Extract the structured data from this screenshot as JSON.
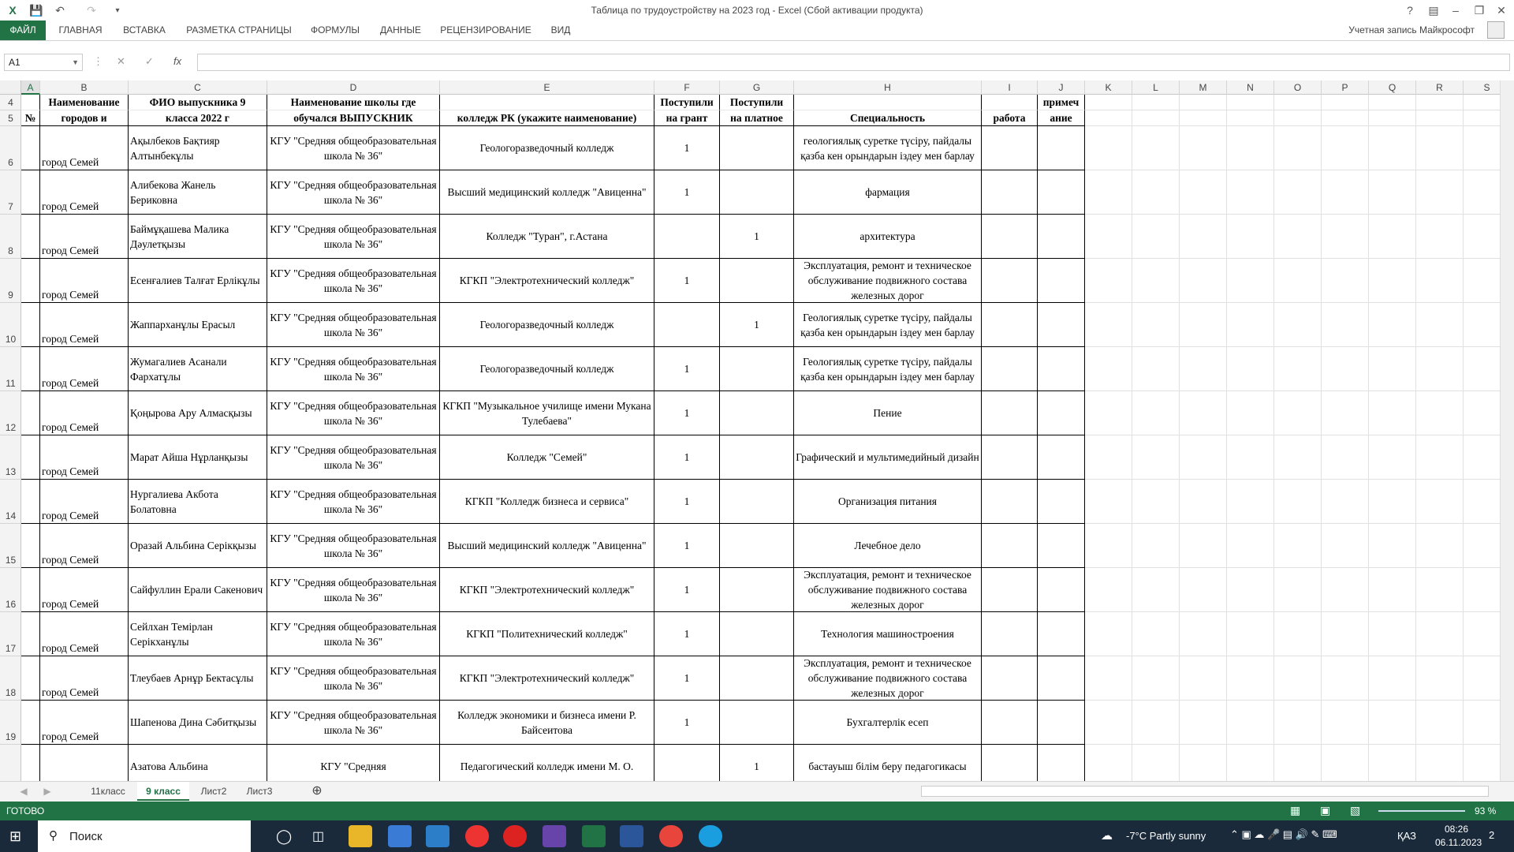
{
  "title": "Таблица по трудоустройству на 2023 год - Excel (Сбой активации продукта)",
  "ribbon": {
    "tabs": [
      "ФАЙЛ",
      "ГЛАВНАЯ",
      "ВСТАВКА",
      "РАЗМЕТКА СТРАНИЦЫ",
      "ФОРМУЛЫ",
      "ДАННЫЕ",
      "РЕЦЕНЗИРОВАНИЕ",
      "ВИД"
    ],
    "account": "Учетная запись Майкрософт"
  },
  "formula_bar": {
    "name_box": "A1",
    "fx": "fx",
    "value": ""
  },
  "columns": [
    "A",
    "B",
    "C",
    "D",
    "E",
    "F",
    "G",
    "H",
    "I",
    "J",
    "K",
    "L",
    "M",
    "N",
    "O",
    "P",
    "Q",
    "R",
    "S"
  ],
  "header": {
    "row4": {
      "B": "Наименование",
      "C": "ФИО выпускника 9",
      "D": "Наименование школы где",
      "F": "Поступили",
      "G": "Поступили",
      "J": "примеч"
    },
    "row5": {
      "A": "№",
      "B": "городов и",
      "C": "класса 2022 г",
      "D": "обучался ВЫПУСКНИК",
      "E": "колледж РК (укажите наименование)",
      "F": "на грант",
      "G": "на платное",
      "H": "Специальность",
      "I": "работа",
      "J": "ание"
    },
    "row_numbers": [
      "4",
      "5"
    ]
  },
  "rows": [
    {
      "num": "6",
      "city": "город Семей",
      "fio": "Ақылбеков Бақтияр Алтынбекұлы",
      "school": "КГУ \"Средняя общеобразовательная школа № 36\"",
      "college": "Геологоразведочный колледж",
      "grant": "1",
      "paid": "",
      "spec": "геологиялық суретке түсіру, пайдалы қазба кен орындарын іздеу мен барлау"
    },
    {
      "num": "7",
      "city": "город Семей",
      "fio": "Алибекова Жанель Бериковна",
      "school": "КГУ \"Средняя общеобразовательная школа № 36\"",
      "college": "Высший медицинский колледж \"Авиценна\"",
      "grant": "1",
      "paid": "",
      "spec": "фармация"
    },
    {
      "num": "8",
      "city": "город Семей",
      "fio": "Баймұқашева Малика Дәулетқызы",
      "school": "КГУ \"Средняя общеобразовательная школа № 36\"",
      "college": "Колледж \"Туран\", г.Астана",
      "grant": "",
      "paid": "1",
      "spec": "архитектура"
    },
    {
      "num": "9",
      "city": "город Семей",
      "fio": "Есенғалиев Талғат Ерлікұлы",
      "school": "КГУ \"Средняя общеобразовательная школа № 36\"",
      "college": "КГКП \"Электротехнический колледж\"",
      "grant": "1",
      "paid": "",
      "spec": "Эксплуатация, ремонт и техническое обслуживание подвижного состава железных дорог"
    },
    {
      "num": "10",
      "city": "город Семей",
      "fio": "Жаппарханұлы Ерасыл",
      "school": "КГУ \"Средняя общеобразовательная школа № 36\"",
      "college": "Геологоразведочный колледж",
      "grant": "",
      "paid": "1",
      "spec": "Геологиялық суретке түсіру, пайдалы қазба кен орындарын іздеу мен барлау"
    },
    {
      "num": "11",
      "city": "город Семей",
      "fio": "Жумагалиев Асанали Фархатұлы",
      "school": "КГУ \"Средняя общеобразовательная школа № 36\"",
      "college": "Геологоразведочный колледж",
      "grant": "1",
      "paid": "",
      "spec": "Геологиялық суретке түсіру, пайдалы қазба кен орындарын іздеу мен барлау"
    },
    {
      "num": "12",
      "city": "город Семей",
      "fio": "Қоңырова Ару Алмасқызы",
      "school": "КГУ \"Средняя общеобразовательная школа № 36\"",
      "college": "КГКП \"Музыкальное училище имени Мукана Тулебаева\"",
      "grant": "1",
      "paid": "",
      "spec": "Пение"
    },
    {
      "num": "13",
      "city": "город Семей",
      "fio": "Марат Айша Нұрланқызы",
      "school": "КГУ \"Средняя общеобразовательная школа № 36\"",
      "college": "Колледж \"Семей\"",
      "grant": "1",
      "paid": "",
      "spec": "Графический и мультимедийный дизайн"
    },
    {
      "num": "14",
      "city": "город Семей",
      "fio": "Нургалиева Акбота Болатовна",
      "school": "КГУ \"Средняя общеобразовательная школа № 36\"",
      "college": "КГКП \"Колледж бизнеса и сервиса\"",
      "grant": "1",
      "paid": "",
      "spec": "Организация питания"
    },
    {
      "num": "15",
      "city": "город Семей",
      "fio": "Оразай Альбина Серікқызы",
      "school": "КГУ \"Средняя общеобразовательная школа № 36\"",
      "college": "Высший медицинский колледж \"Авиценна\"",
      "grant": "1",
      "paid": "",
      "spec": "Лечебное дело"
    },
    {
      "num": "16",
      "city": "город Семей",
      "fio": "Сайфуллин Ерали Сакенович",
      "school": "КГУ \"Средняя общеобразовательная школа № 36\"",
      "college": "КГКП \"Электротехнический колледж\"",
      "grant": "1",
      "paid": "",
      "spec": "Эксплуатация, ремонт и техническое обслуживание подвижного состава железных дорог"
    },
    {
      "num": "17",
      "city": "город Семей",
      "fio": "Сейлхан Темірлан Серікханұлы",
      "school": "КГУ \"Средняя общеобразовательная школа № 36\"",
      "college": "КГКП \"Политехнический колледж\"",
      "grant": "1",
      "paid": "",
      "spec": "Технология машиностроения"
    },
    {
      "num": "18",
      "city": "город Семей",
      "fio": "Тлеубаев Арнұр Бектасұлы",
      "school": "КГУ \"Средняя общеобразовательная школа № 36\"",
      "college": "КГКП \"Электротехнический колледж\"",
      "grant": "1",
      "paid": "",
      "spec": "Эксплуатация, ремонт и техническое обслуживание подвижного состава железных дорог"
    },
    {
      "num": "19",
      "city": "город Семей",
      "fio": "Шапенова Дина Сәбитқызы",
      "school": "КГУ \"Средняя общеобразовательная школа № 36\"",
      "college": "Колледж экономики и бизнеса имени Р. Байсеитова",
      "grant": "1",
      "paid": "",
      "spec": "Бухгалтерлік есеп"
    },
    {
      "num": "",
      "city": "",
      "fio": "Азатова Альбина",
      "school": "КГУ \"Средняя",
      "college": "Педагогический колледж имени М. О.",
      "grant": "",
      "paid": "1",
      "spec": "бастауыш білім беру педагогикасы"
    }
  ],
  "sheets": [
    "11класс",
    "9 класс",
    "Лист2",
    "Лист3"
  ],
  "active_sheet": "9 класс",
  "status": {
    "ready": "ГОТОВО",
    "zoom": "93 %"
  },
  "taskbar": {
    "search": "Поиск",
    "weather": "-7°C  Partly sunny",
    "lang": "ҚАЗ",
    "time": "08:26",
    "date": "06.11.2023",
    "notif": "2"
  },
  "colors": {
    "excel_green": "#217346",
    "taskbar": "#1b2a3a"
  }
}
